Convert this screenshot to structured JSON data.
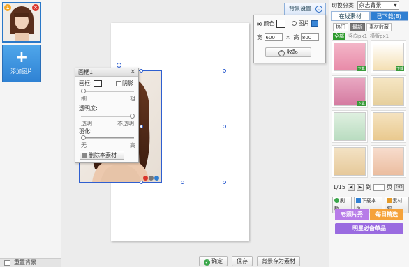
{
  "sidebar": {
    "thumb_badge": "1",
    "thumb_close": "×",
    "add_label": "添加图片",
    "add_plus": "+",
    "reset_bg_label": "重置背景"
  },
  "frame_panel": {
    "title": "画框1",
    "close": "×",
    "border_label": "画框:",
    "shadow_label": "阴影",
    "thin_label": "细",
    "thick_label": "粗",
    "opacity_label": "透明度:",
    "transparent_label": "透明",
    "opaque_label": "不透明",
    "feather_label": "羽化:",
    "none_label": "无",
    "high_label": "高",
    "delete_label": "删除本素材"
  },
  "bg_panel": {
    "tab_label": "背景设置",
    "tab_icon": "⌄",
    "color_label": "颜色",
    "image_label": "图片",
    "width_label": "宽",
    "width_value": "600",
    "height_label": "高",
    "height_value": "800",
    "times": "×",
    "collapse_label": "收起"
  },
  "toolbar": {
    "confirm_label": "确定",
    "save_label": "保存",
    "save_as_material_label": "背景存为素材"
  },
  "material_panel": {
    "category_label": "切换分类",
    "category_value": "杂志背景",
    "tab_online": "在线素材",
    "tab_downloaded": "已下载(8)",
    "subtab_hot": "热门",
    "subtab_new": "最新",
    "subtab_collection": "素材收藏",
    "filter_all": "全部",
    "filter_portrait": "竖向px1",
    "filter_landscape": "横版px1",
    "page_text": "1/15",
    "goto_label": "到",
    "page_unit": "页",
    "go_label": "GO",
    "refresh_label": "刷新",
    "download_page_label": "下载本页",
    "material_pack_label": "素材包",
    "tile_tag": "下载",
    "promo1_a": "老照片秀",
    "promo1_b": "每日精选",
    "promo2": "明星必备单品"
  },
  "colors": {
    "accent": "#2f7fd2",
    "selection": "#2f5fd0",
    "promo_purple": "#b77be8",
    "promo_orange": "#f5a23a",
    "promo_violet": "#9a6be0"
  }
}
